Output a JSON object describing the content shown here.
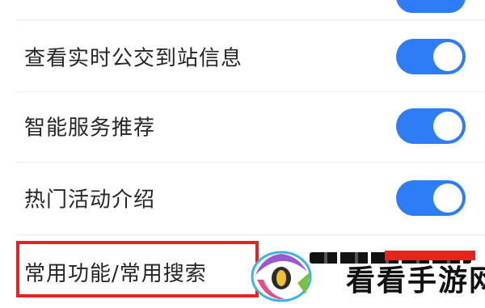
{
  "settings": {
    "items": [
      {
        "label": "查看实时公交到站信息",
        "enabled": true
      },
      {
        "label": "智能服务推荐",
        "enabled": true
      },
      {
        "label": "热门活动介绍",
        "enabled": true
      }
    ],
    "highlighted_item": {
      "label": "常用功能/常用搜索"
    }
  },
  "colors": {
    "toggle_on": "#2e7cf6",
    "highlight_border": "#e8231e",
    "text": "#262626"
  },
  "watermark": {
    "text": "看看手游网",
    "logo_icon": "kankan-logo-icon"
  }
}
